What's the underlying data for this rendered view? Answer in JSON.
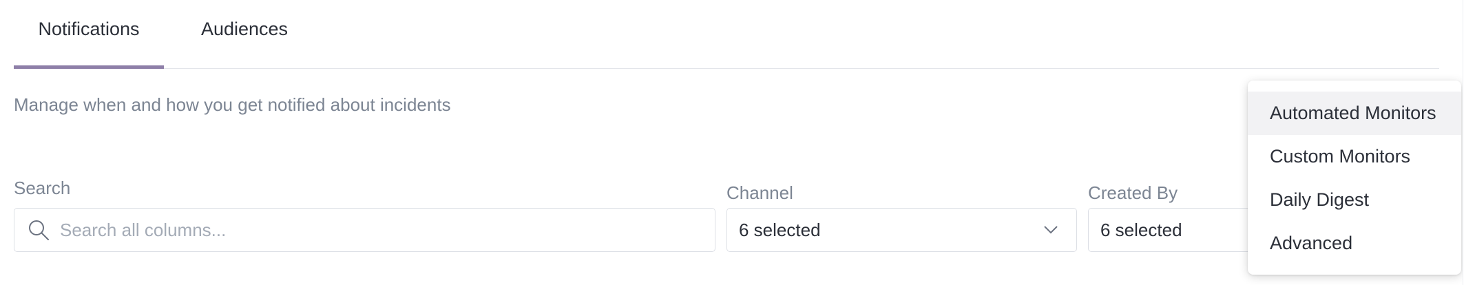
{
  "tabs": [
    {
      "label": "Notifications",
      "active": true
    },
    {
      "label": "Audiences",
      "active": false
    }
  ],
  "accent_color": "#8e7fa8",
  "description": "Manage when and how you get notified about incidents",
  "filters": {
    "search": {
      "label": "Search",
      "placeholder": "Search all columns...",
      "value": "",
      "icon": "search-icon"
    },
    "channel": {
      "label": "Channel",
      "value": "6 selected",
      "icon": "chevron-down-icon"
    },
    "created_by": {
      "label": "Created By",
      "value": "6 selected"
    }
  },
  "dropdown": {
    "items": [
      {
        "label": "Automated Monitors",
        "highlighted": true
      },
      {
        "label": "Custom Monitors",
        "highlighted": false
      },
      {
        "label": "Daily Digest",
        "highlighted": false
      },
      {
        "label": "Advanced",
        "highlighted": false
      }
    ]
  }
}
